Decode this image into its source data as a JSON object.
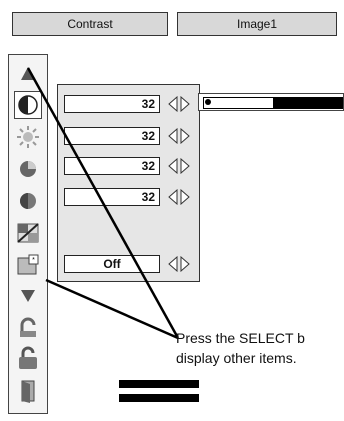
{
  "header": {
    "menu_title": "Contrast",
    "mode_title": "Image1"
  },
  "toolbar": {
    "items": [
      {
        "name": "scroll-up-icon"
      },
      {
        "name": "contrast-icon"
      },
      {
        "name": "brightness-icon"
      },
      {
        "name": "color-icon"
      },
      {
        "name": "tint-icon"
      },
      {
        "name": "color-temp-icon"
      },
      {
        "name": "white-balance-icon"
      },
      {
        "name": "scroll-down-icon"
      },
      {
        "name": "reset-icon"
      },
      {
        "name": "store-icon"
      },
      {
        "name": "quit-icon"
      }
    ]
  },
  "settings": {
    "rows": [
      {
        "value": "32"
      },
      {
        "value": "32"
      },
      {
        "value": "32"
      },
      {
        "value": "32"
      },
      {
        "value": "Off"
      }
    ]
  },
  "slider": {
    "level": 0.5
  },
  "hint": {
    "line1": "Press the SELECT b",
    "line2": "display other items."
  },
  "colors": {
    "accent": "#000000",
    "panel": "#e6e6e6",
    "header": "#d8d8d8"
  }
}
